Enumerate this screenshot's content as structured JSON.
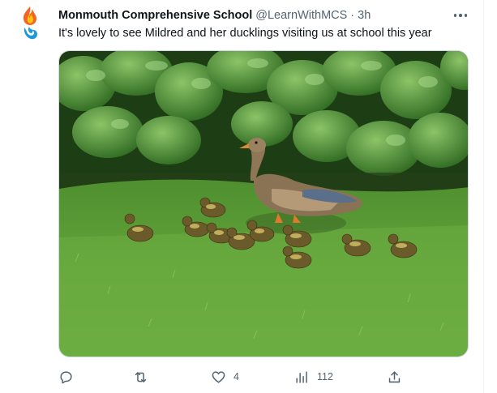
{
  "tweet": {
    "author_name": "Monmouth Comprehensive School",
    "author_handle": "@LearnWithMCS",
    "separator": "·",
    "time": "3h",
    "text": "It's lovely to see Mildred and her ducklings visiting us at school this year",
    "media_alt": "A mallard duck with ducklings walking on grass in front of a hedge"
  },
  "actions": {
    "reply_count": "",
    "retweet_count": "",
    "like_count": "4",
    "views_count": "112"
  },
  "icons": {
    "avatar": "flame-logo-icon",
    "more": "more-dots-icon",
    "reply": "reply-icon",
    "retweet": "retweet-icon",
    "like": "heart-icon",
    "views": "views-icon",
    "share": "share-icon"
  },
  "colors": {
    "text": "#0f1419",
    "secondary": "#536471",
    "border": "#cfd9de"
  }
}
